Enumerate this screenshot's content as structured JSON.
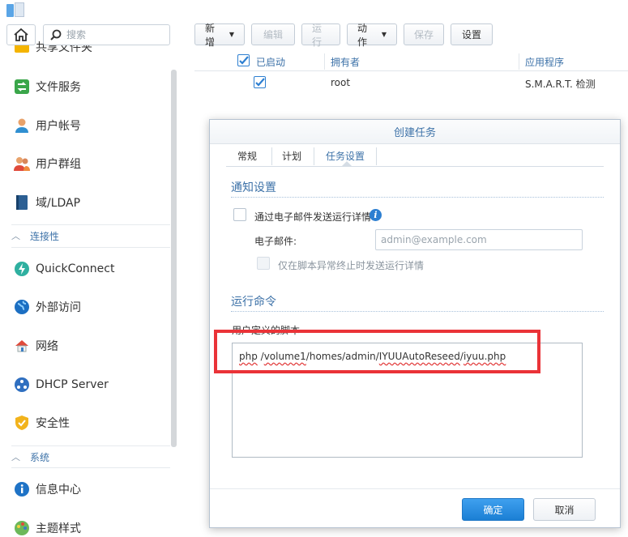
{
  "search": {
    "placeholder": "搜索"
  },
  "sidebar": {
    "items": [
      {
        "label": "共享文件夹",
        "icon": "shared-folder-icon"
      },
      {
        "label": "文件服务",
        "icon": "file-services-icon"
      },
      {
        "label": "用户帐号",
        "icon": "user-icon"
      },
      {
        "label": "用户群组",
        "icon": "group-icon"
      },
      {
        "label": "域/LDAP",
        "icon": "domain-ldap-icon"
      },
      {
        "label": "QuickConnect",
        "icon": "quickconnect-icon"
      },
      {
        "label": "外部访问",
        "icon": "external-access-icon"
      },
      {
        "label": "网络",
        "icon": "network-icon"
      },
      {
        "label": "DHCP Server",
        "icon": "dhcp-icon"
      },
      {
        "label": "安全性",
        "icon": "security-icon"
      },
      {
        "label": "信息中心",
        "icon": "info-center-icon"
      },
      {
        "label": "主题样式",
        "icon": "theme-icon"
      }
    ],
    "sections": [
      {
        "label": "连接性"
      },
      {
        "label": "系统"
      }
    ]
  },
  "toolbar": {
    "create": "新增",
    "edit": "编辑",
    "run": "运行",
    "action": "动作",
    "save": "保存",
    "settings": "设置"
  },
  "table": {
    "headers": {
      "enabled": "已启动",
      "owner": "拥有者",
      "application": "应用程序"
    },
    "rows": [
      {
        "owner": "root",
        "application": "S.M.A.R.T. 检测"
      }
    ]
  },
  "dialog": {
    "title": "创建任务",
    "tabs": [
      "常规",
      "计划",
      "任务设置"
    ],
    "notify": {
      "title": "通知设置",
      "send_email": "通过电子邮件发送运行详情",
      "email_label": "电子邮件:",
      "email_placeholder": "admin@example.com",
      "only_on_error": "仅在脚本异常终止时发送运行详情"
    },
    "run_command": {
      "title": "运行命令",
      "script_label": "用户定义的脚本",
      "script_parts": [
        "php",
        " /",
        "volume1",
        "/homes/admin/",
        "IYUUAutoReseed",
        "/",
        "iyuu.php"
      ]
    },
    "ok": "确定",
    "cancel": "取消"
  },
  "colors": {
    "accent": "#3d72a8",
    "primary_button": "#1b7fd4",
    "highlight": "#ea3338"
  }
}
